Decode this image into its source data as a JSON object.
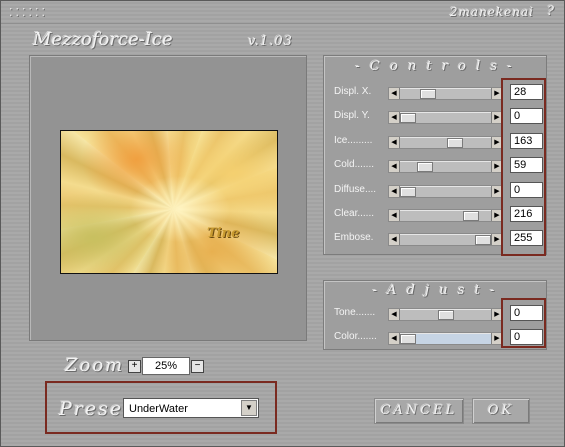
{
  "window": {
    "dots": "⁚⁚⁚⁚⁚⁚",
    "author": "2manekenai",
    "help": "?",
    "app_name": "Mezzoforce-Ice",
    "version": "v.1.03"
  },
  "preview": {
    "watermark": "Tine"
  },
  "controls": {
    "title": "- C o n t r o l s -",
    "sliders": [
      {
        "label": "Displ. X.",
        "value": "28",
        "level": 0.27
      },
      {
        "label": "Displ. Y.",
        "value": "0",
        "level": 0.0
      },
      {
        "label": "Ice.........",
        "value": "163",
        "level": 0.63
      },
      {
        "label": "Cold.......",
        "value": "59",
        "level": 0.23
      },
      {
        "label": "Diffuse....",
        "value": "0",
        "level": 0.0
      },
      {
        "label": "Clear......",
        "value": "216",
        "level": 0.84
      },
      {
        "label": "Embose.",
        "value": "255",
        "level": 1.0
      }
    ]
  },
  "adjust": {
    "title": "- A d j u s t -",
    "sliders": [
      {
        "label": "Tone.......",
        "value": "0",
        "level": 0.5
      },
      {
        "label": "Color.......",
        "value": "0",
        "level": 0.0
      }
    ]
  },
  "zoom": {
    "label": "Zoom",
    "plus": "+",
    "minus": "−",
    "value": "25%"
  },
  "preset": {
    "label": "Preset",
    "selected": "UnderWater",
    "arrow": "▼"
  },
  "buttons": {
    "cancel": "CANCEL",
    "ok": "OK"
  },
  "colors": {
    "highlight": "#7a2a20",
    "panel": "#9e9e9e",
    "background": "#a6a6a6"
  }
}
